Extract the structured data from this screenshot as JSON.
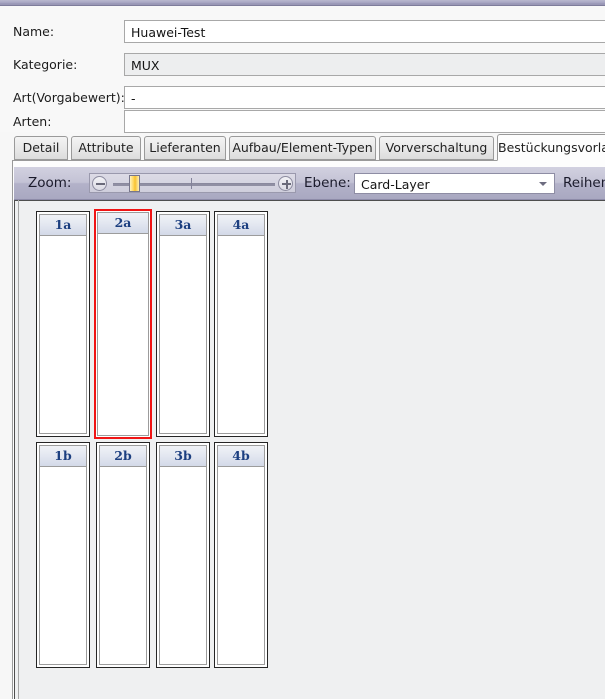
{
  "form": {
    "rows": [
      {
        "label": "Name:",
        "value": "Huawei-Test",
        "readonly": false
      },
      {
        "label": "Kategorie:",
        "value": "MUX",
        "readonly": true
      },
      {
        "label": "Art(Vorgabewert):",
        "value": "-",
        "readonly": false
      },
      {
        "label": "Arten:",
        "value": "",
        "readonly": false
      }
    ]
  },
  "tabs": [
    {
      "label": "Detail",
      "active": false
    },
    {
      "label": "Attribute",
      "active": false
    },
    {
      "label": "Lieferanten",
      "active": false
    },
    {
      "label": "Aufbau/Element-Typen",
      "active": false
    },
    {
      "label": "Vorverschaltung",
      "active": false
    },
    {
      "label": "Bestückungsvorlage",
      "active": true
    }
  ],
  "toolbar": {
    "zoom_label": "Zoom:",
    "zoom_minus": "zoom-out-icon",
    "zoom_plus": "zoom-in-icon",
    "ebene_label": "Ebene:",
    "ebene_value": "Card-Layer",
    "reihen_label": "Reihenn"
  },
  "rack": {
    "rows": [
      {
        "name": "row-a",
        "slots": [
          {
            "label": "1a",
            "selected": false
          },
          {
            "label": "2a",
            "selected": true
          },
          {
            "label": "3a",
            "selected": false
          },
          {
            "label": "4a",
            "selected": false
          }
        ]
      },
      {
        "name": "row-b",
        "slots": [
          {
            "label": "1b",
            "selected": false
          },
          {
            "label": "2b",
            "selected": false
          },
          {
            "label": "3b",
            "selected": false
          },
          {
            "label": "4b",
            "selected": false
          }
        ]
      }
    ]
  },
  "colors": {
    "accent_bar": "#a7a5c2",
    "toolbar": "#b3b2c9",
    "selection": "#f01414",
    "slot_label": "#1c3f80",
    "canvas_bg": "#eff0f1"
  }
}
